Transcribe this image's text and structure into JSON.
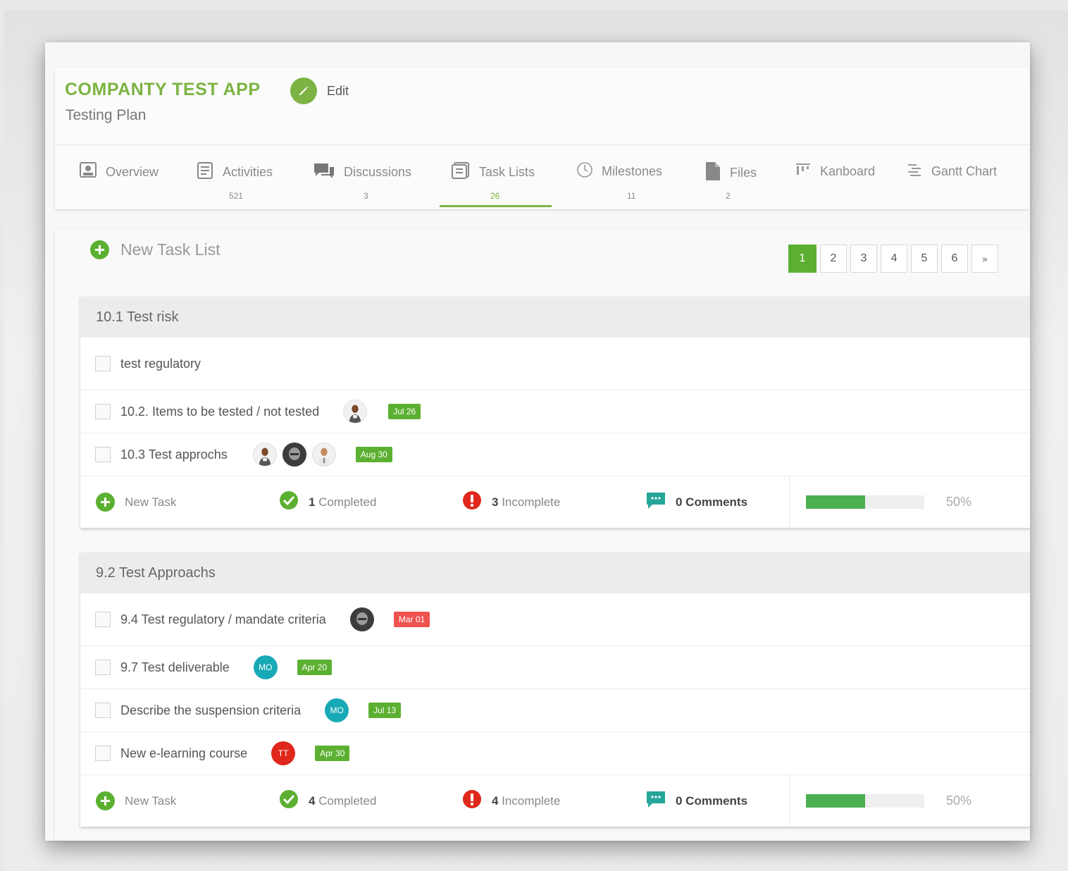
{
  "header": {
    "app_title": "COMPANTY TEST APP",
    "subtitle": "Testing Plan",
    "edit_label": "Edit"
  },
  "tabs": [
    {
      "label": "Overview",
      "count": "",
      "icon": "overview-icon"
    },
    {
      "label": "Activities",
      "count": "521",
      "icon": "activities-icon"
    },
    {
      "label": "Discussions",
      "count": "3",
      "icon": "discussions-icon"
    },
    {
      "label": "Task Lists",
      "count": "26",
      "icon": "task-lists-icon",
      "active": true
    },
    {
      "label": "Milestones",
      "count": "11",
      "icon": "milestones-icon"
    },
    {
      "label": "Files",
      "count": "2",
      "icon": "files-icon"
    },
    {
      "label": "Kanboard",
      "count": "",
      "icon": "kanboard-icon"
    },
    {
      "label": "Gantt Chart",
      "count": "",
      "icon": "gantt-chart-icon"
    }
  ],
  "main": {
    "new_task_list_label": "New Task List",
    "pages": [
      "1",
      "2",
      "3",
      "4",
      "5",
      "6"
    ],
    "next_page_label": "»",
    "current_page": "1"
  },
  "task_lists": [
    {
      "title": "10.1 Test risk",
      "tasks": [
        {
          "name": "test  regulatory",
          "avatars": [],
          "due": "",
          "due_color": ""
        },
        {
          "name": "10.2. Items to be tested / not tested",
          "avatars": [
            {
              "type": "photo",
              "initials": ""
            }
          ],
          "due": "Jul 26",
          "due_color": "green"
        },
        {
          "name": "10.3 Test approchs",
          "avatars": [
            {
              "type": "photo",
              "initials": ""
            },
            {
              "type": "photo-dark",
              "initials": ""
            },
            {
              "type": "photo",
              "initials": ""
            }
          ],
          "due": "Aug 30",
          "due_color": "green"
        }
      ],
      "footer": {
        "new_task_label": "New Task",
        "completed_count": "1",
        "completed_label": "Completed",
        "incomplete_count": "3",
        "incomplete_label": "Incomplete",
        "comments_label": "0 Comments",
        "progress_percent": 50,
        "progress_label": "50%"
      }
    },
    {
      "title": "9.2 Test Approachs",
      "tasks": [
        {
          "name": "9.4 Test regulatory / mandate criteria",
          "avatars": [
            {
              "type": "photo-dark",
              "initials": ""
            }
          ],
          "due": "Mar 01",
          "due_color": "red"
        },
        {
          "name": "9.7 Test deliverable",
          "avatars": [
            {
              "type": "teal",
              "initials": "MO"
            }
          ],
          "due": "Apr 20",
          "due_color": "green"
        },
        {
          "name": "Describe the suspension criteria",
          "avatars": [
            {
              "type": "teal",
              "initials": "MO"
            }
          ],
          "due": "Jul 13",
          "due_color": "green"
        },
        {
          "name": "New e-learning course",
          "avatars": [
            {
              "type": "red",
              "initials": "TT"
            }
          ],
          "due": "Apr 30",
          "due_color": "green"
        }
      ],
      "footer": {
        "new_task_label": "New Task",
        "completed_count": "4",
        "completed_label": "Completed",
        "incomplete_count": "4",
        "incomplete_label": "Incomplete",
        "comments_label": "0 Comments",
        "progress_percent": 50,
        "progress_label": "50%"
      }
    }
  ],
  "colors": {
    "brand_green": "#7cb342",
    "badge_green": "#5cb031",
    "badge_red": "#ef5350",
    "progress_green": "#4caf50",
    "avatar_teal": "#17a9b6",
    "avatar_red": "#e0271c"
  }
}
